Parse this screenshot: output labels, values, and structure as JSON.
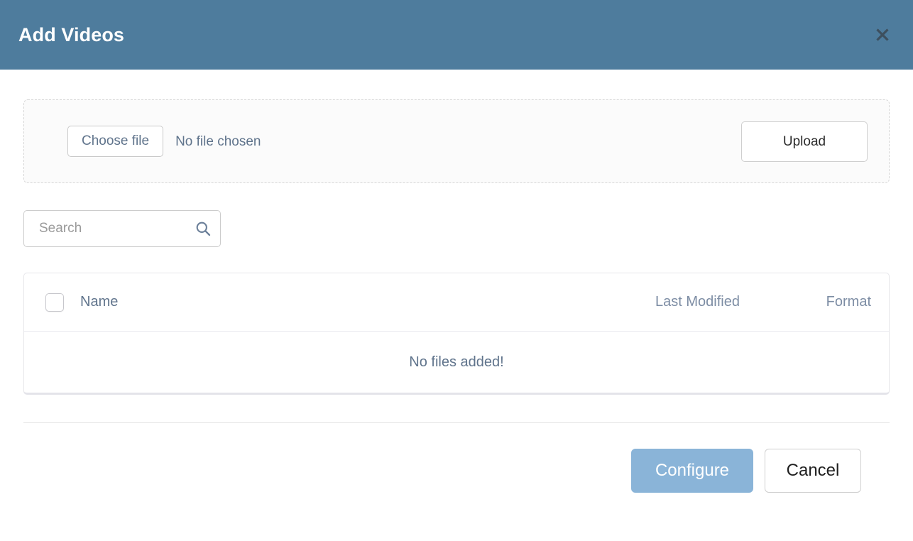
{
  "header": {
    "title": "Add Videos",
    "close_label": "×"
  },
  "upload": {
    "choose_file_label": "Choose file",
    "no_file_text": "No file chosen",
    "upload_label": "Upload"
  },
  "search": {
    "placeholder": "Search",
    "value": "",
    "icon": "search-icon"
  },
  "table": {
    "columns": {
      "name": "Name",
      "last_modified": "Last Modified",
      "format": "Format"
    },
    "rows": [],
    "empty_message": "No files added!"
  },
  "footer": {
    "configure_label": "Configure",
    "cancel_label": "Cancel"
  },
  "colors": {
    "header_bg": "#4e7c9d",
    "primary_button": "#8ab4d8",
    "slate_text": "#60748c",
    "muted_header_text": "#7d8da4",
    "dropzone_bg": "#fbfbfb",
    "dropzone_border": "#d6d6d6"
  }
}
